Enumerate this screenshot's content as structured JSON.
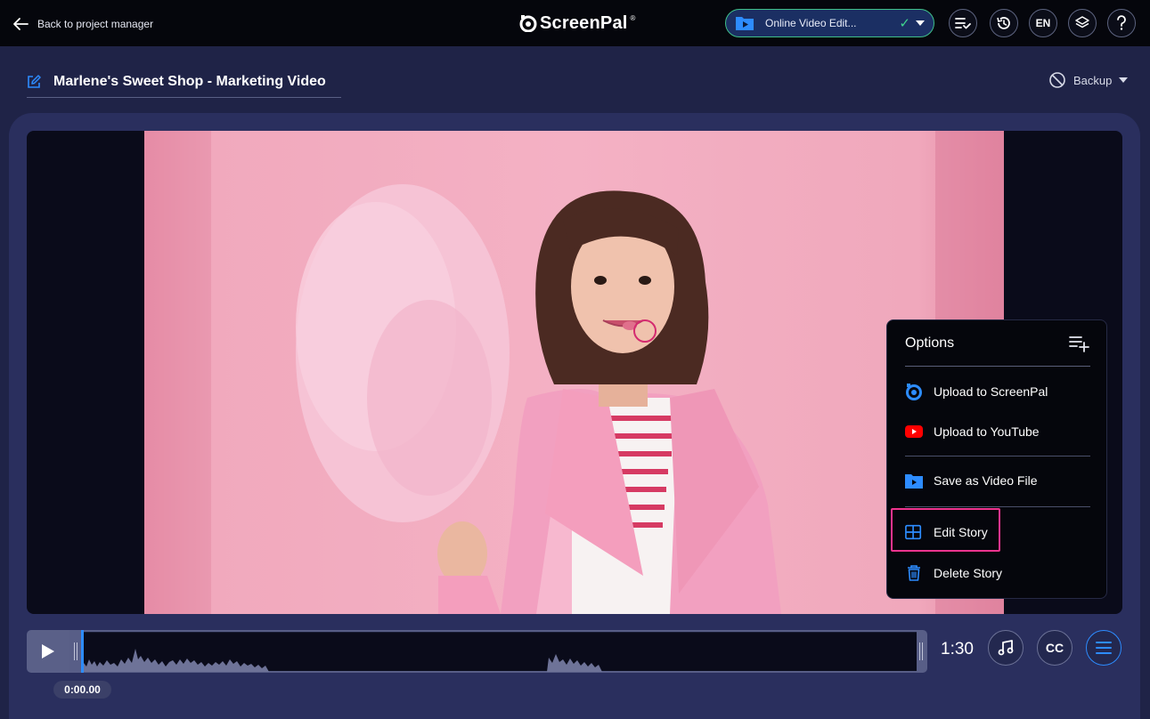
{
  "header": {
    "back_label": "Back to project manager",
    "logo_text": "ScreenPal",
    "logo_mark": "®",
    "project_name": "Online Video Edit...",
    "language": "EN"
  },
  "project": {
    "title": "Marlene's Sweet Shop - Marketing Video",
    "backup_label": "Backup"
  },
  "options_menu": {
    "title": "Options",
    "items": [
      {
        "label": "Upload to ScreenPal",
        "icon": "screenpal-icon"
      },
      {
        "label": "Upload to YouTube",
        "icon": "youtube-icon"
      },
      {
        "label": "Save as Video File",
        "icon": "video-folder-icon"
      },
      {
        "label": "Edit Story",
        "icon": "story-grid-icon"
      },
      {
        "label": "Delete Story",
        "icon": "trash-icon"
      }
    ]
  },
  "timeline": {
    "current_time": "0:00.00",
    "duration": "1:30",
    "cc_label": "CC"
  },
  "colors": {
    "accent_blue": "#2d8cff",
    "success_green": "#3fd48d",
    "highlight_pink": "#f0348f",
    "youtube_red": "#ff0000"
  }
}
